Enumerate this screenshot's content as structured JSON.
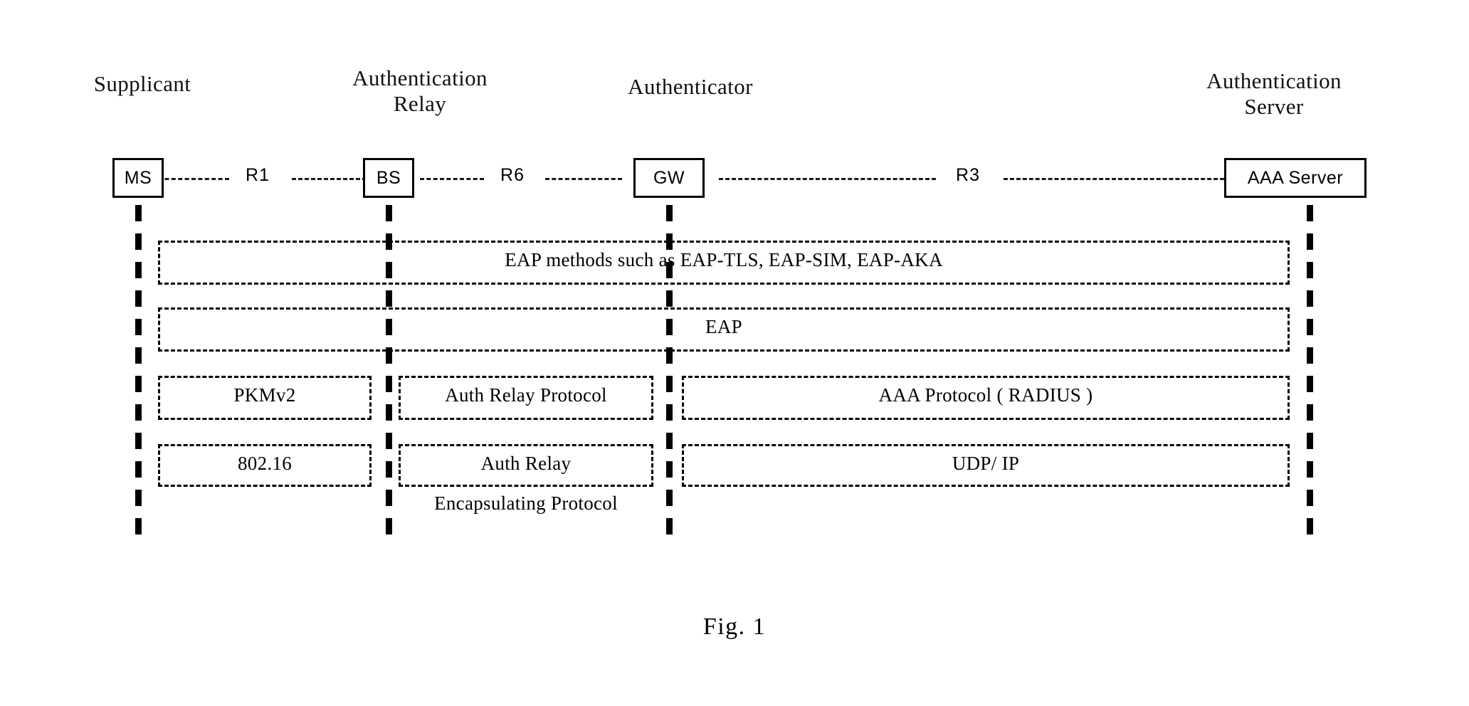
{
  "figure": {
    "caption": "Fig. 1"
  },
  "roles": [
    {
      "name": "supplicant",
      "label": "Supplicant"
    },
    {
      "name": "authentication-relay",
      "label": "Authentication\nRelay"
    },
    {
      "name": "authenticator",
      "label": "Authenticator"
    },
    {
      "name": "authentication-server",
      "label": "Authentication\nServer"
    }
  ],
  "nodes": [
    {
      "name": "ms",
      "label": "MS"
    },
    {
      "name": "bs",
      "label": "BS"
    },
    {
      "name": "gw",
      "label": "GW"
    },
    {
      "name": "aaa-server",
      "label": "AAA Server"
    }
  ],
  "reference_points": [
    {
      "name": "r1",
      "label": "R1"
    },
    {
      "name": "r6",
      "label": "R6"
    },
    {
      "name": "r3",
      "label": "R3"
    }
  ],
  "layers": {
    "eap_methods": {
      "label": "EAP methods such as EAP-TLS, EAP-SIM, EAP-AKA"
    },
    "eap": {
      "label": "EAP"
    },
    "pkmv2": {
      "label": "PKMv2"
    },
    "auth_relay_protocol": {
      "label": "Auth Relay Protocol"
    },
    "aaa_protocol": {
      "label": "AAA Protocol ( RADIUS )"
    },
    "ieee80216": {
      "label": "802.16"
    },
    "auth_relay": {
      "label": "Auth Relay"
    },
    "encapsulating_protocol": {
      "label": "Encapsulating Protocol"
    },
    "udp_ip": {
      "label": "UDP/ IP"
    }
  },
  "colors": {
    "ink": "#000000",
    "background": "#ffffff"
  }
}
